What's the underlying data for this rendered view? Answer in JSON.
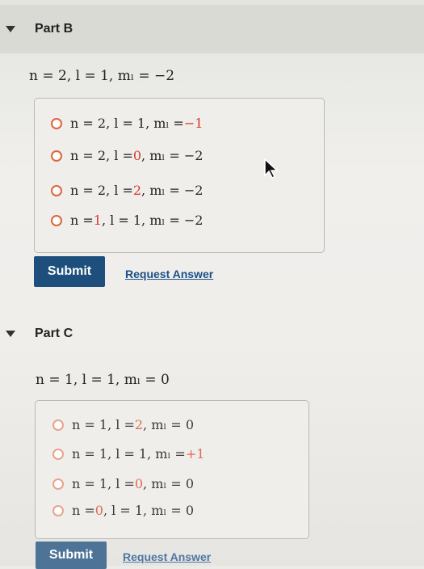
{
  "part_b": {
    "title": "Part B",
    "question": "n = 2, l = 1, mₗ = −2",
    "options": [
      {
        "pre": "n = 2, l = 1, mₗ = ",
        "red": "−1",
        "post": ""
      },
      {
        "pre": "n = 2, l = ",
        "red": "0",
        "post": ", mₗ = −2"
      },
      {
        "pre": "n = 2, l = ",
        "red": "2",
        "post": ", mₗ = −2"
      },
      {
        "pre": "n = ",
        "red": "1",
        "post": ", l = 1, mₗ = −2"
      }
    ],
    "submit_label": "Submit",
    "request_label": "Request Answer"
  },
  "part_c": {
    "title": "Part C",
    "question": "n = 1, l = 1, mₗ = 0",
    "options": [
      {
        "pre": "n = 1, l = ",
        "red": "2",
        "post": ", mₗ = 0"
      },
      {
        "pre": "n = 1, l = 1, mₗ = ",
        "red": "+1",
        "post": ""
      },
      {
        "pre": "n = 1, l = ",
        "red": "0",
        "post": ", mₗ = 0"
      },
      {
        "pre": "n = ",
        "red": "0",
        "post": ", l = 1, mₗ = 0"
      }
    ],
    "submit_label": "Submit",
    "request_label": "Request Answer"
  },
  "icons": {
    "collapse": "triangle-down-icon",
    "cursor": "mouse-pointer-icon",
    "radio": "radio-unselected-icon"
  },
  "colors": {
    "highlight": "#d83b2b",
    "submit_bg": "#1e4f7c",
    "link": "#1b4f85",
    "radio_border": "#e0643a"
  }
}
